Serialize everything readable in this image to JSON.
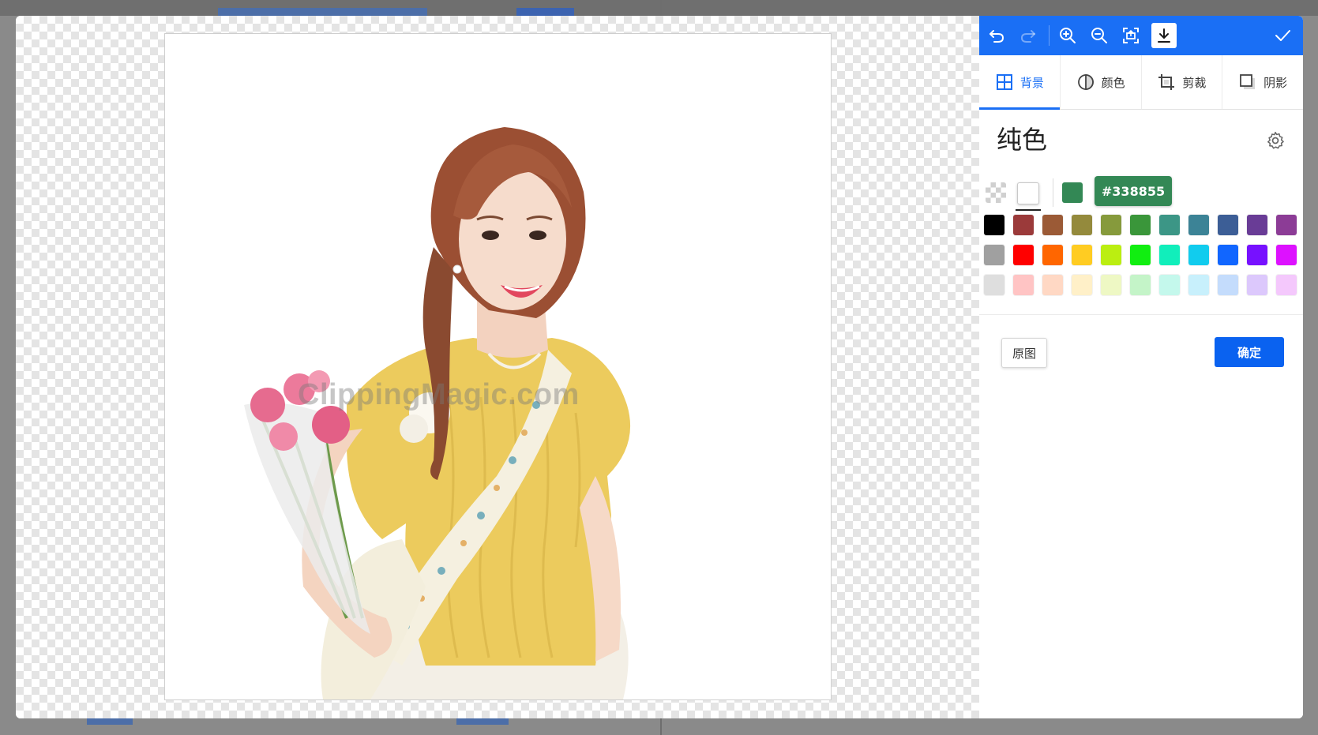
{
  "toolbar": {
    "undo_icon": "undo-icon",
    "redo_icon": "redo-icon",
    "zoom_in_icon": "zoom-in-icon",
    "zoom_out_icon": "zoom-out-icon",
    "fit_icon": "fit-to-screen-icon",
    "download_icon": "download-icon",
    "confirm_icon": "checkmark-icon",
    "color": "#1a6ff5"
  },
  "tabs": [
    {
      "label": "背景",
      "icon": "grid-icon",
      "active": true
    },
    {
      "label": "颜色",
      "icon": "contrast-icon",
      "active": false
    },
    {
      "label": "剪裁",
      "icon": "crop-icon",
      "active": false
    },
    {
      "label": "阴影",
      "icon": "shadow-icon",
      "active": false
    }
  ],
  "panel": {
    "section_title": "纯色",
    "settings_icon": "gear-icon",
    "selected_hex": "#338855",
    "original_button": "原图",
    "confirm_button": "确定"
  },
  "palette": [
    [
      "#000000",
      "#9b3a3a",
      "#9b5a36",
      "#948a3c",
      "#869a3c",
      "#3a963a",
      "#3c9686",
      "#3c8396",
      "#3c5e96",
      "#693c96",
      "#8c3c96"
    ],
    [
      "#a0a0a0",
      "#ff0000",
      "#ff6600",
      "#ffcc22",
      "#bbee11",
      "#11ee11",
      "#11eebb",
      "#11ccee",
      "#1166ff",
      "#7711ff",
      "#dd11ff"
    ],
    [
      "#dedede",
      "#ffc4c4",
      "#ffd8c4",
      "#fff0c8",
      "#eef8c4",
      "#c4f4c8",
      "#c4f8ec",
      "#c8f0fc",
      "#c4dcfc",
      "#dcc8fc",
      "#f4c8fc"
    ]
  ],
  "image": {
    "watermark": "ClippingMagic.com"
  }
}
